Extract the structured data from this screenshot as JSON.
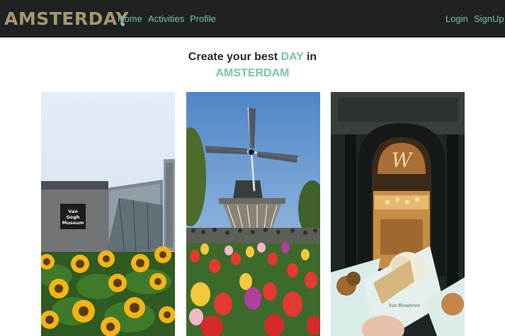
{
  "navbar": {
    "brand": "AMSTERDAY",
    "links": [
      "Home",
      "Activities",
      "Profile"
    ],
    "auth": [
      "Login",
      "SignUp"
    ]
  },
  "hero": {
    "line1_prefix": "Create your best ",
    "line1_accent": "DAY",
    "line1_suffix": " in",
    "line2": "AMSTERDAM"
  },
  "cards": [
    {
      "image_label": "Van Gogh Museum",
      "sign_text": [
        "Van",
        "Gogh",
        "Museum"
      ]
    },
    {
      "image_label": "windmill-tulips"
    },
    {
      "image_label": "van-wonderen-stroopwafels",
      "shop_text": "Van Wonderen"
    }
  ],
  "colors": {
    "navbar_bg": "#1f2124",
    "brand": "#a7966f",
    "accent": "#79c5ae"
  }
}
